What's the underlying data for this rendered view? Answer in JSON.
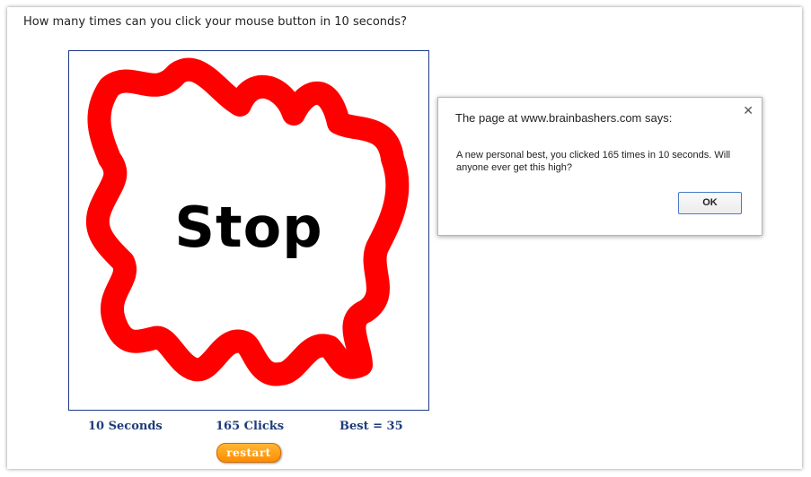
{
  "page": {
    "question": "How many times can you click your mouse button in 10 seconds?"
  },
  "game": {
    "status_text": "Stop",
    "scribble_color": "#ff0000",
    "stats": {
      "seconds_label": "10 Seconds",
      "clicks_label": "165 Clicks",
      "best_label": "Best = 35"
    },
    "restart_label": "restart"
  },
  "dialog": {
    "title": "The page at www.brainbashers.com says:",
    "close_icon": "close-icon",
    "message": "A new personal best, you clicked 165 times in 10 seconds. Will anyone ever get this high?",
    "ok_label": "OK"
  }
}
